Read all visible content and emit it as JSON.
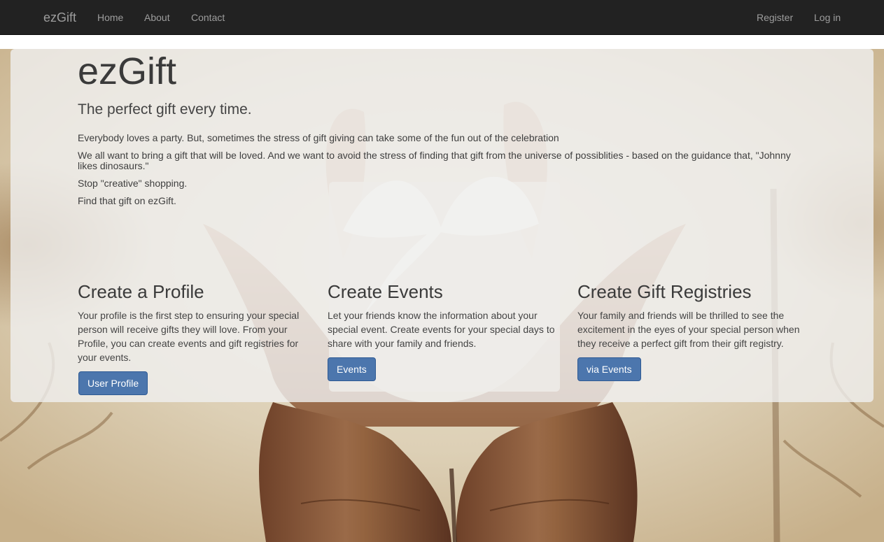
{
  "navbar": {
    "brand": "ezGift",
    "links": [
      "Home",
      "About",
      "Contact"
    ],
    "right_links": [
      "Register",
      "Log in"
    ]
  },
  "hero": {
    "title": "ezGift",
    "tagline": "The perfect gift every time.",
    "paragraphs": [
      "Everybody loves a party. But, sometimes the stress of gift giving can take some of the fun out of the celebration",
      "We all want to bring a gift that will be loved. And we want to avoid the stress of finding that gift from the universe of possiblities - based on the guidance that, \"Johnny likes dinosaurs.\"",
      "Stop \"creative\" shopping.",
      "Find that gift on ezGift."
    ]
  },
  "features": [
    {
      "heading": "Create a Profile",
      "text": "Your profile is the first step to ensuring your special person will receive gifts they will love. From your Profile, you can create events and gift registries for your events.",
      "button": "User Profile"
    },
    {
      "heading": "Create Events",
      "text": "Let your friends know the information about your special event. Create events for your special days to share with your family and friends.",
      "button": "Events"
    },
    {
      "heading": "Create Gift Registries",
      "text": "Your family and friends will be thrilled to see the excitement in the eyes of your special person when they receive a perfect gift from their gift registry.",
      "button": "via Events"
    }
  ],
  "colors": {
    "navbar_bg": "#222222",
    "nav_text": "#9d9d9d",
    "button_bg": "#4c76ad",
    "overlay": "rgba(240,240,240,0.80)"
  }
}
